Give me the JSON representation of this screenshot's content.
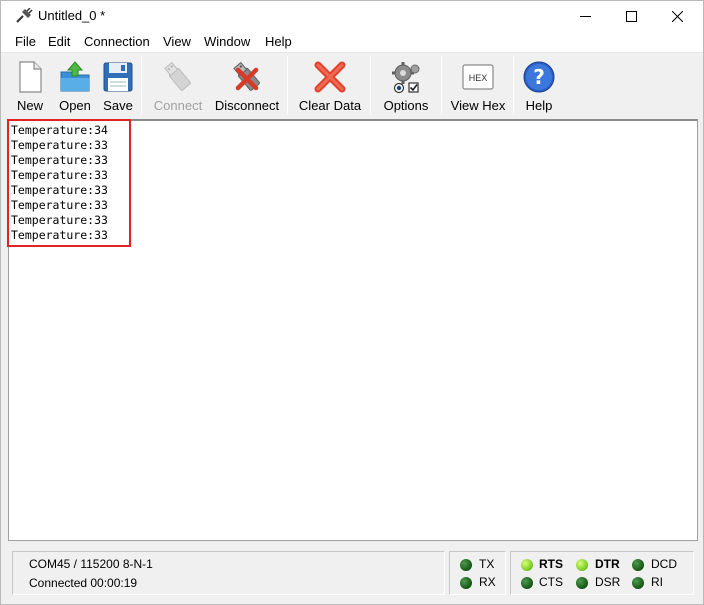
{
  "window": {
    "title": "Untitled_0 *"
  },
  "menu": [
    "File",
    "Edit",
    "Connection",
    "View",
    "Window",
    "Help"
  ],
  "toolbar": {
    "new": "New",
    "open": "Open",
    "save": "Save",
    "connect": "Connect",
    "disconnect": "Disconnect",
    "clear_data": "Clear Data",
    "options": "Options",
    "view_hex": "View Hex",
    "hex_icon_text": "HEX",
    "help": "Help"
  },
  "terminal": {
    "lines": [
      "Temperature:34",
      "Temperature:33",
      "Temperature:33",
      "Temperature:33",
      "Temperature:33",
      "Temperature:33",
      "Temperature:33",
      "Temperature:33"
    ]
  },
  "status": {
    "port_settings": "COM45 / 115200 8-N-1",
    "connection": "Connected 00:00:19",
    "leds": {
      "tx": {
        "label": "TX",
        "on": false
      },
      "rx": {
        "label": "RX",
        "on": false
      },
      "rts": {
        "label": "RTS",
        "on": true
      },
      "cts": {
        "label": "CTS",
        "on": false
      },
      "dtr": {
        "label": "DTR",
        "on": true
      },
      "dsr": {
        "label": "DSR",
        "on": false
      },
      "dcd": {
        "label": "DCD",
        "on": false
      },
      "ri": {
        "label": "RI",
        "on": false
      }
    }
  },
  "colors": {
    "highlight": "#e02424",
    "led_on": "#8ee02a",
    "led_off": "#1a6b1a"
  }
}
